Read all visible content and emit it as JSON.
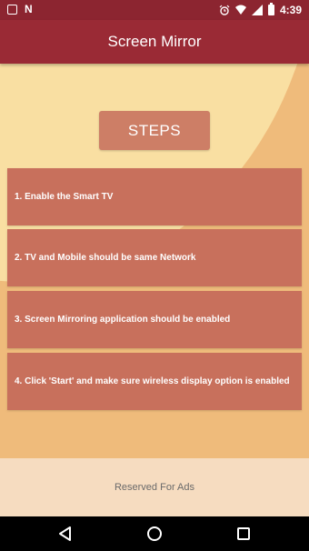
{
  "status_bar": {
    "left_icons": [
      "gallery-icon",
      "n-notification-icon"
    ],
    "right_icons": [
      "alarm-icon",
      "wifi-icon",
      "signal-icon",
      "battery-icon"
    ],
    "time": "4:39"
  },
  "app_bar": {
    "title": "Screen Mirror"
  },
  "steps_button": {
    "label": "STEPS"
  },
  "steps": [
    "1.  Enable the Smart TV",
    "2.  TV and Mobile should be same Network",
    "3.  Screen Mirroring application should be enabled",
    "4.  Click 'Start' and make sure wireless display option is enabled"
  ],
  "ads": {
    "label": "Reserved For Ads"
  },
  "nav_bar": {
    "buttons": [
      "back-icon",
      "home-icon",
      "recents-icon"
    ]
  },
  "colors": {
    "app_bar": "#9a2a35",
    "status_bar": "#8c2530",
    "background_light": "#f9dfa2",
    "background_dark": "#efbb7b",
    "step_card": "#c8705c",
    "steps_button": "#cd7e66",
    "ads_area": "#f6dcc0"
  }
}
